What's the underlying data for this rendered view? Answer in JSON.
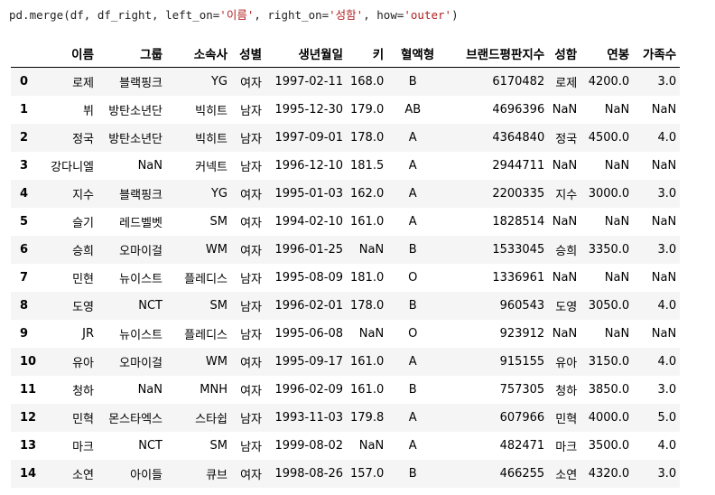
{
  "code": {
    "prefix": "pd.merge(df, df_right, left_on=",
    "left_on": "'이름'",
    "sep1": ", right_on=",
    "right_on": "'성함'",
    "sep2": ", how=",
    "how": "'outer'",
    "suffix": ")"
  },
  "table": {
    "columns": [
      "",
      "이름",
      "그룹",
      "소속사",
      "성별",
      "생년월일",
      "키",
      "혈액형",
      "브랜드평판지수",
      "성함",
      "연봉",
      "가족수"
    ],
    "rows": [
      [
        "0",
        "로제",
        "블랙핑크",
        "YG",
        "여자",
        "1997-02-11",
        "168.0",
        "B",
        "6170482",
        "로제",
        "4200.0",
        "3.0"
      ],
      [
        "1",
        "뷔",
        "방탄소년단",
        "빅히트",
        "남자",
        "1995-12-30",
        "179.0",
        "AB",
        "4696396",
        "NaN",
        "NaN",
        "NaN"
      ],
      [
        "2",
        "정국",
        "방탄소년단",
        "빅히트",
        "남자",
        "1997-09-01",
        "178.0",
        "A",
        "4364840",
        "정국",
        "4500.0",
        "4.0"
      ],
      [
        "3",
        "강다니엘",
        "NaN",
        "커넥트",
        "남자",
        "1996-12-10",
        "181.5",
        "A",
        "2944711",
        "NaN",
        "NaN",
        "NaN"
      ],
      [
        "4",
        "지수",
        "블랙핑크",
        "YG",
        "여자",
        "1995-01-03",
        "162.0",
        "A",
        "2200335",
        "지수",
        "3000.0",
        "3.0"
      ],
      [
        "5",
        "슬기",
        "레드벨벳",
        "SM",
        "여자",
        "1994-02-10",
        "161.0",
        "A",
        "1828514",
        "NaN",
        "NaN",
        "NaN"
      ],
      [
        "6",
        "승희",
        "오마이걸",
        "WM",
        "여자",
        "1996-01-25",
        "NaN",
        "B",
        "1533045",
        "승희",
        "3350.0",
        "3.0"
      ],
      [
        "7",
        "민현",
        "뉴이스트",
        "플레디스",
        "남자",
        "1995-08-09",
        "181.0",
        "O",
        "1336961",
        "NaN",
        "NaN",
        "NaN"
      ],
      [
        "8",
        "도영",
        "NCT",
        "SM",
        "남자",
        "1996-02-01",
        "178.0",
        "B",
        "960543",
        "도영",
        "3050.0",
        "4.0"
      ],
      [
        "9",
        "JR",
        "뉴이스트",
        "플레디스",
        "남자",
        "1995-06-08",
        "NaN",
        "O",
        "923912",
        "NaN",
        "NaN",
        "NaN"
      ],
      [
        "10",
        "유아",
        "오마이걸",
        "WM",
        "여자",
        "1995-09-17",
        "161.0",
        "A",
        "915155",
        "유아",
        "3150.0",
        "4.0"
      ],
      [
        "11",
        "청하",
        "NaN",
        "MNH",
        "여자",
        "1996-02-09",
        "161.0",
        "B",
        "757305",
        "청하",
        "3850.0",
        "3.0"
      ],
      [
        "12",
        "민혁",
        "몬스타엑스",
        "스타쉽",
        "남자",
        "1993-11-03",
        "179.8",
        "A",
        "607966",
        "민혁",
        "4000.0",
        "5.0"
      ],
      [
        "13",
        "마크",
        "NCT",
        "SM",
        "남자",
        "1999-08-02",
        "NaN",
        "A",
        "482471",
        "마크",
        "3500.0",
        "4.0"
      ],
      [
        "14",
        "소연",
        "아이들",
        "큐브",
        "여자",
        "1998-08-26",
        "157.0",
        "B",
        "466255",
        "소연",
        "4320.0",
        "3.0"
      ]
    ]
  }
}
